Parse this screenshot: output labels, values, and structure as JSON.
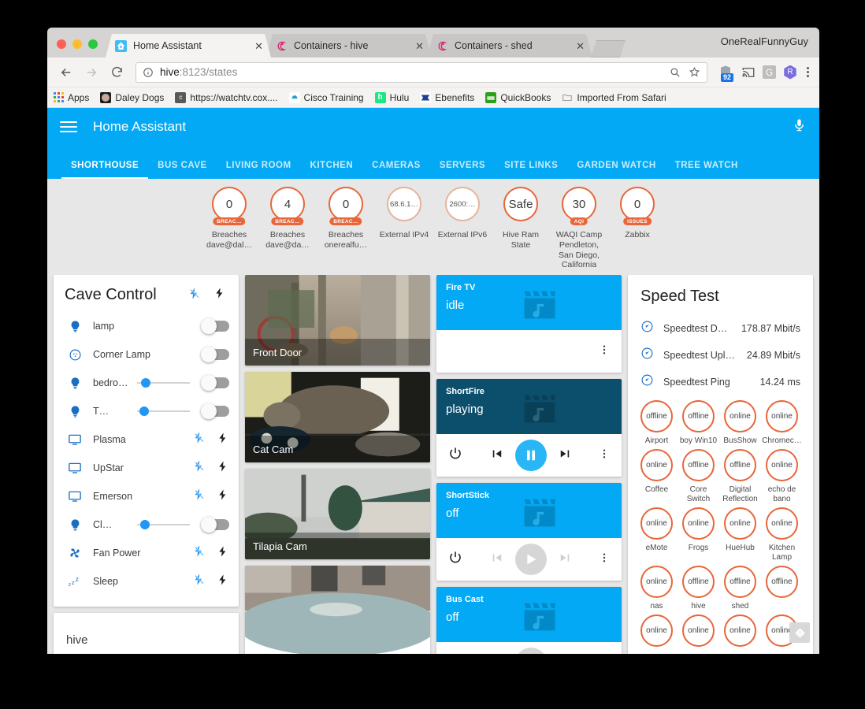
{
  "window": {
    "user_label": "OneRealFunnyGuy",
    "tabs": [
      {
        "title": "Home Assistant",
        "favicon": "home-assistant-icon",
        "active": true
      },
      {
        "title": "Containers - hive",
        "favicon": "portainer-icon",
        "active": false
      },
      {
        "title": "Containers - shed",
        "favicon": "portainer-icon",
        "active": false
      }
    ],
    "new_tab_label": "+"
  },
  "toolbar": {
    "back_icon": "back-arrow-icon",
    "forward_icon": "forward-arrow-icon",
    "reload_icon": "reload-icon",
    "info_icon": "page-info-icon",
    "url_host": "hive",
    "url_rest": ":8123/states",
    "zoom_icon": "zoom-out-icon",
    "star_icon": "bookmark-star-icon",
    "extensions": [
      {
        "name": "ublock-origin-icon",
        "badge": "92"
      },
      {
        "name": "cast-icon",
        "badge": ""
      },
      {
        "name": "google-icon",
        "label": "G"
      },
      {
        "name": "profile-avatar-icon",
        "label": "R"
      }
    ],
    "menu_icon": "chrome-menu-icon"
  },
  "bookmarks": [
    {
      "label": "Apps",
      "icon": "apps-grid-icon"
    },
    {
      "label": "Daley Dogs",
      "icon": "daley-dogs-icon"
    },
    {
      "label": "https://watchtv.cox....",
      "icon": "cox-icon"
    },
    {
      "label": "Cisco Training",
      "icon": "cisco-icon"
    },
    {
      "label": "Hulu",
      "icon": "hulu-icon"
    },
    {
      "label": "Ebenefits",
      "icon": "ebenefits-icon"
    },
    {
      "label": "QuickBooks",
      "icon": "quickbooks-icon"
    },
    {
      "label": "Imported From Safari",
      "icon": "folder-icon"
    }
  ],
  "ha": {
    "accent": "#03a9f4",
    "app_title": "Home Assistant",
    "menu_icon": "hamburger-menu-icon",
    "mic_icon": "microphone-icon",
    "tabs": [
      {
        "label": "SHORTHOUSE",
        "selected": true
      },
      {
        "label": "BUS CAVE",
        "selected": false
      },
      {
        "label": "LIVING ROOM",
        "selected": false
      },
      {
        "label": "KITCHEN",
        "selected": false
      },
      {
        "label": "CAMERAS",
        "selected": false
      },
      {
        "label": "SERVERS",
        "selected": false
      },
      {
        "label": "SITE LINKS",
        "selected": false
      },
      {
        "label": "GARDEN WATCH",
        "selected": false
      },
      {
        "label": "TREE WATCH",
        "selected": false
      }
    ],
    "badges": [
      {
        "value": "0",
        "pill": "BREAC…",
        "name": "Breaches dave@dal…",
        "small": false,
        "thin": false
      },
      {
        "value": "4",
        "pill": "BREAC…",
        "name": "Breaches dave@da…",
        "small": false,
        "thin": false
      },
      {
        "value": "0",
        "pill": "BREAC…",
        "name": "Breaches onerealfu…",
        "small": false,
        "thin": false
      },
      {
        "value": "68.6.1…",
        "pill": "",
        "name": "External IPv4",
        "small": true,
        "thin": true
      },
      {
        "value": "2600:…",
        "pill": "",
        "name": "External IPv6",
        "small": true,
        "thin": true
      },
      {
        "value": "Safe",
        "pill": "",
        "name": "Hive Ram State",
        "small": false,
        "thin": false
      },
      {
        "value": "30",
        "pill": "AQI",
        "name": "WAQI Camp Pendleton, San Diego, California",
        "small": false,
        "thin": false
      },
      {
        "value": "0",
        "pill": "ISSUES",
        "name": "Zabbix",
        "small": false,
        "thin": false
      }
    ],
    "cave_control": {
      "title": "Cave Control",
      "header_actions": [
        "flash-off-icon",
        "flash-on-icon"
      ],
      "rows": [
        {
          "icon": "lightbulb-icon",
          "label": "lamp",
          "control": "toggle",
          "toggle_on": false
        },
        {
          "icon": "ceiling-light-icon",
          "label": "Corner Lamp",
          "control": "toggle",
          "toggle_on": false
        },
        {
          "icon": "lightbulb-icon",
          "label": "bedro…",
          "control": "slider-toggle",
          "slider_pct": 8,
          "toggle_on": false
        },
        {
          "icon": "lightbulb-icon",
          "label": "T…",
          "control": "slider-toggle",
          "slider_pct": 4,
          "toggle_on": false
        },
        {
          "icon": "monitor-icon",
          "label": "Plasma",
          "control": "flash-pair"
        },
        {
          "icon": "monitor-icon",
          "label": "UpStar",
          "control": "flash-pair"
        },
        {
          "icon": "monitor-icon",
          "label": "Emerson",
          "control": "flash-pair"
        },
        {
          "icon": "lightbulb-icon",
          "label": "Cl…",
          "control": "slider-toggle",
          "slider_pct": 6,
          "toggle_on": false
        },
        {
          "icon": "fan-icon",
          "label": "Fan Power",
          "control": "flash-pair"
        },
        {
          "icon": "sleep-icon",
          "label": "Sleep",
          "control": "flash-pair"
        }
      ]
    },
    "hive_card": {
      "title": "hive"
    },
    "cameras": [
      {
        "caption": "Front Door",
        "scene": "front-door"
      },
      {
        "caption": "Cat Cam",
        "scene": "cat-cam"
      },
      {
        "caption": "Tilapia Cam",
        "scene": "tilapia-cam"
      },
      {
        "caption": "",
        "scene": "pool-cam"
      }
    ],
    "media_players": [
      {
        "name": "Fire TV",
        "state": "idle",
        "header_color": "#03a9f4",
        "controls": [],
        "more_icon": "more-vert-icon",
        "art_icon": "media-art-icon"
      },
      {
        "name": "ShortFire",
        "state": "playing",
        "header_color": "#0b4f6c",
        "controls": [
          "power-icon",
          "previous-track-icon",
          "pause-icon",
          "next-track-icon"
        ],
        "play_state": "pause",
        "more_icon": "more-vert-icon",
        "art_icon": "media-art-icon"
      },
      {
        "name": "ShortStick",
        "state": "off",
        "header_color": "#03a9f4",
        "controls": [
          "power-icon",
          "previous-track-icon",
          "play-icon",
          "next-track-icon"
        ],
        "play_state": "play",
        "disabled": true,
        "more_icon": "more-vert-icon",
        "art_icon": "media-art-icon"
      },
      {
        "name": "Bus Cast",
        "state": "off",
        "header_color": "#03a9f4",
        "controls": [
          "power-icon",
          "previous-track-icon",
          "play-icon",
          "next-track-icon"
        ],
        "play_state": "play",
        "disabled": true,
        "more_icon": "more-vert-icon",
        "art_icon": "media-art-icon"
      }
    ],
    "speed_test": {
      "title": "Speed Test",
      "rows": [
        {
          "icon": "speedometer-icon",
          "label": "Speedtest Downlo…",
          "value": "178.87 Mbit/s"
        },
        {
          "icon": "speedometer-icon",
          "label": "Speedtest Upload",
          "value": "24.89 Mbit/s"
        },
        {
          "icon": "speedometer-icon",
          "label": "Speedtest Ping",
          "value": "14.24 ms"
        }
      ],
      "entities": [
        {
          "state": "offline",
          "name": "Airport"
        },
        {
          "state": "offline",
          "name": "boy Win10"
        },
        {
          "state": "online",
          "name": "BusShow"
        },
        {
          "state": "online",
          "name": "Chromec…"
        },
        {
          "state": "online",
          "name": "Coffee"
        },
        {
          "state": "offline",
          "name": "Core Switch"
        },
        {
          "state": "offline",
          "name": "Digital Reflection"
        },
        {
          "state": "online",
          "name": "echo de bano"
        },
        {
          "state": "online",
          "name": "eMote"
        },
        {
          "state": "online",
          "name": "Frogs"
        },
        {
          "state": "online",
          "name": "HueHub"
        },
        {
          "state": "online",
          "name": "Kitchen Lamp"
        },
        {
          "state": "online",
          "name": "nas"
        },
        {
          "state": "offline",
          "name": "hive"
        },
        {
          "state": "offline",
          "name": "shed"
        },
        {
          "state": "offline",
          "name": ""
        },
        {
          "state": "online",
          "name": ""
        },
        {
          "state": "online",
          "name": ""
        },
        {
          "state": "online",
          "name": ""
        },
        {
          "state": "online",
          "name": ""
        }
      ]
    },
    "fab": {
      "icon": "feedly-icon"
    }
  }
}
